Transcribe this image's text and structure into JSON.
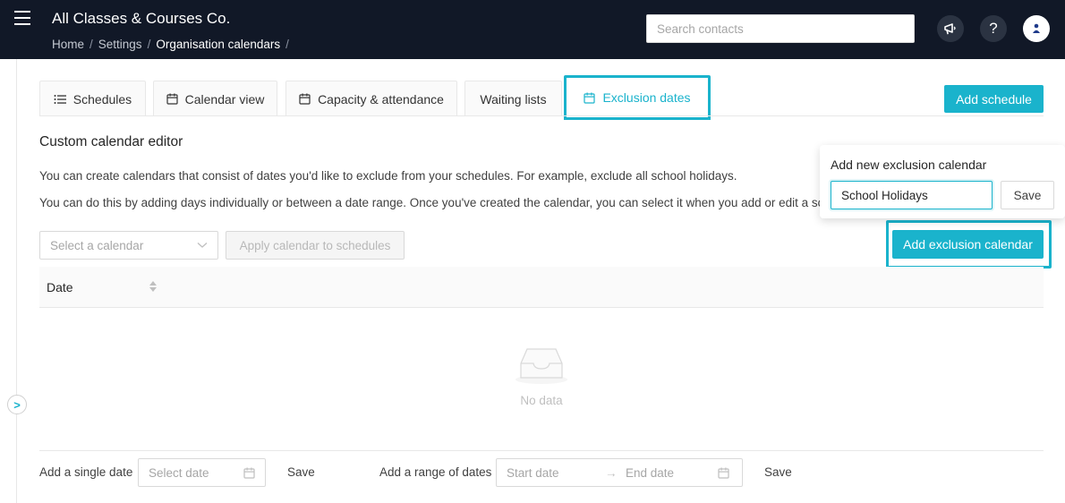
{
  "header": {
    "org_name": "All Classes & Courses Co.",
    "breadcrumb": [
      "Home",
      "Settings",
      "Organisation calendars"
    ],
    "search_placeholder": "Search contacts",
    "help_label": "?"
  },
  "tabs": [
    {
      "label": "Schedules",
      "icon": "list-icon"
    },
    {
      "label": "Calendar view",
      "icon": "calendar-icon"
    },
    {
      "label": "Capacity & attendance",
      "icon": "calendar-icon"
    },
    {
      "label": "Waiting lists",
      "icon": ""
    },
    {
      "label": "Exclusion dates",
      "icon": "calendar-icon",
      "active": true
    }
  ],
  "add_schedule_label": "Add schedule",
  "editor": {
    "title": "Custom calendar editor",
    "desc1": "You can create calendars that consist of dates you'd like to exclude from your schedules. For example, exclude all school holidays.",
    "desc2": "You can do this by adding days individually or between a date range. Once you've created the calendar, you can select it when you add or edit a sche",
    "select_placeholder": "Select a calendar",
    "apply_label": "Apply calendar to schedules",
    "add_exclusion_label": "Add exclusion calendar"
  },
  "table": {
    "column_date": "Date",
    "empty_text": "No data"
  },
  "footer": {
    "single_label": "Add a single date",
    "single_placeholder": "Select date",
    "single_save": "Save",
    "range_label": "Add a range of dates",
    "range_start": "Start date",
    "range_arrow": "→",
    "range_end": "End date",
    "range_save": "Save"
  },
  "popover": {
    "title": "Add new exclusion calendar",
    "input_value": "School Holidays",
    "save_label": "Save"
  },
  "collapse_label": ">",
  "colors": {
    "header_bg": "#111827",
    "accent": "#1ab3cc"
  }
}
